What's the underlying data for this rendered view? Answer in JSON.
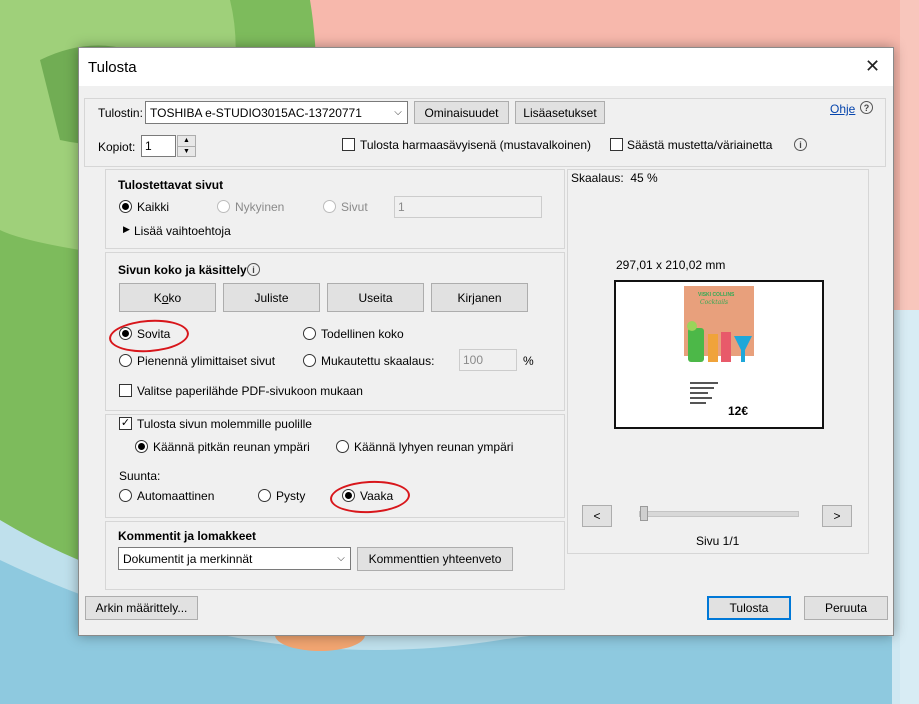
{
  "dialog": {
    "title": "Tulosta",
    "help_link": "Ohje"
  },
  "printer": {
    "label": "Tulostin:",
    "selected": "TOSHIBA e-STUDIO3015AC-13720771",
    "properties_button": "Ominaisuudet",
    "advanced_button": "Lisäasetukset"
  },
  "copies": {
    "label": "Kopiot:",
    "value": "1"
  },
  "options": {
    "grayscale_label": "Tulosta harmaasävyisenä (mustavalkoinen)",
    "grayscale_checked": false,
    "save_ink_label": "Säästä mustetta/väriainetta",
    "save_ink_checked": false
  },
  "pages_to_print": {
    "heading": "Tulostettavat sivut",
    "all": "Kaikki",
    "current": "Nykyinen",
    "pages": "Sivut",
    "pages_value": "1",
    "more_options": "Lisää vaihtoehtoja",
    "selected": "Kaikki"
  },
  "page_sizing": {
    "heading": "Sivun koko ja käsittely",
    "tabs": [
      "Koko",
      "Juliste",
      "Useita",
      "Kirjanen"
    ],
    "fit": "Sovita",
    "actual_size": "Todellinen koko",
    "shrink": "Pienennä ylimittaiset sivut",
    "custom_scale": "Mukautettu skaalaus:",
    "custom_scale_value": "100",
    "percent": "%",
    "selected": "Sovita",
    "paper_source_label": "Valitse paperilähde PDF-sivukoon mukaan",
    "paper_source_checked": false
  },
  "duplex": {
    "label": "Tulosta sivun molemmille puolille",
    "checked": true,
    "long_edge": "Käännä pitkän reunan ympäri",
    "short_edge": "Käännä lyhyen reunan ympäri",
    "selected": "Käännä pitkän reunan ympäri"
  },
  "orientation": {
    "label": "Suunta:",
    "auto": "Automaattinen",
    "portrait": "Pysty",
    "landscape": "Vaaka",
    "selected": "Vaaka"
  },
  "comments": {
    "heading": "Kommentit ja lomakkeet",
    "selected": "Dokumentit ja merkinnät",
    "summary_button": "Kommenttien yhteenveto"
  },
  "preview": {
    "scale_text": "Skaalaus:  45 %",
    "dimensions": "297,01 x 210,02 mm",
    "page_text": "Sivu 1/1",
    "prev": "<",
    "next": ">",
    "slider_value": 0,
    "thumb": {
      "title_line1": "VISKI COLLINS",
      "title_line2": "Cocktails",
      "price": "12€",
      "colors": {
        "header": "#e8a07c",
        "glass1": "#4cb848",
        "glass2": "#f0a33a",
        "glass3": "#e85a6a",
        "glass4": "#1fa7d9"
      }
    }
  },
  "footer": {
    "page_setup": "Arkin määrittely...",
    "print": "Tulosta",
    "cancel": "Peruuta"
  },
  "colors": {
    "accent": "#0078d7",
    "annotation": "#d8161b"
  }
}
